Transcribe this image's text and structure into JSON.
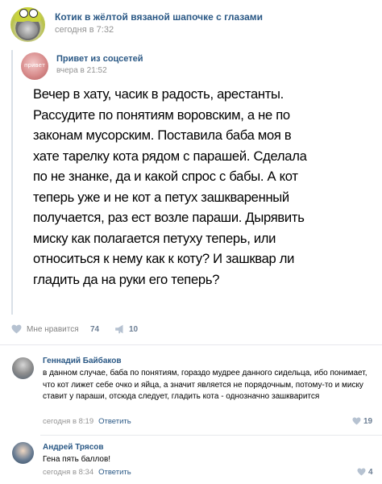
{
  "post": {
    "author": "Котик в жёлтой вязаной шапочке с глазами",
    "time": "сегодня в 7:32",
    "repost": {
      "author": "Привет из соцсетей",
      "time": "вчера в 21:52",
      "avatar_text": "привет",
      "text": "Вечер в хату, часик в радость, арестанты.\nРассудите по понятиям воровским, а не по\nзаконам мусорским. Поставила баба моя в\nхате тарелку кота рядом с парашей. Сделала\nпо не знанке, да и какой спрос с бабы. А кот\nтеперь уже и не кот а петух зашкваренный\nполучается, раз ест возле параши. Дырявить\nмиску как полагается петуху теперь, или\nотноситься к нему как к коту? И зашквар ли\nгладить да на руки его теперь?"
    },
    "actions": {
      "like_label": "Мне нравится",
      "like_count": "74",
      "share_count": "10"
    }
  },
  "comments": [
    {
      "author": "Геннадий Байбаков",
      "text": "в данном случае, баба по понятиям, гораздо мудрее данного сидельца, ибо понимает, что кот лижет себе очко и яйца, а значит является не порядочным, потому-то и миску ставит у параши, отсюда следует, гладить кота - однозначно зашкварится",
      "time": "сегодня в 8:19",
      "reply": "Ответить",
      "likes": "19"
    },
    {
      "author": "Андрей Трясов",
      "text": "Гена пять баллов!",
      "time": "сегодня в 8:34",
      "reply": "Ответить",
      "likes": "4"
    }
  ],
  "colors": {
    "link": "#2a5885",
    "meta": "#939393",
    "divider": "#e7e8ec",
    "repost_bar": "#dae1e8"
  }
}
